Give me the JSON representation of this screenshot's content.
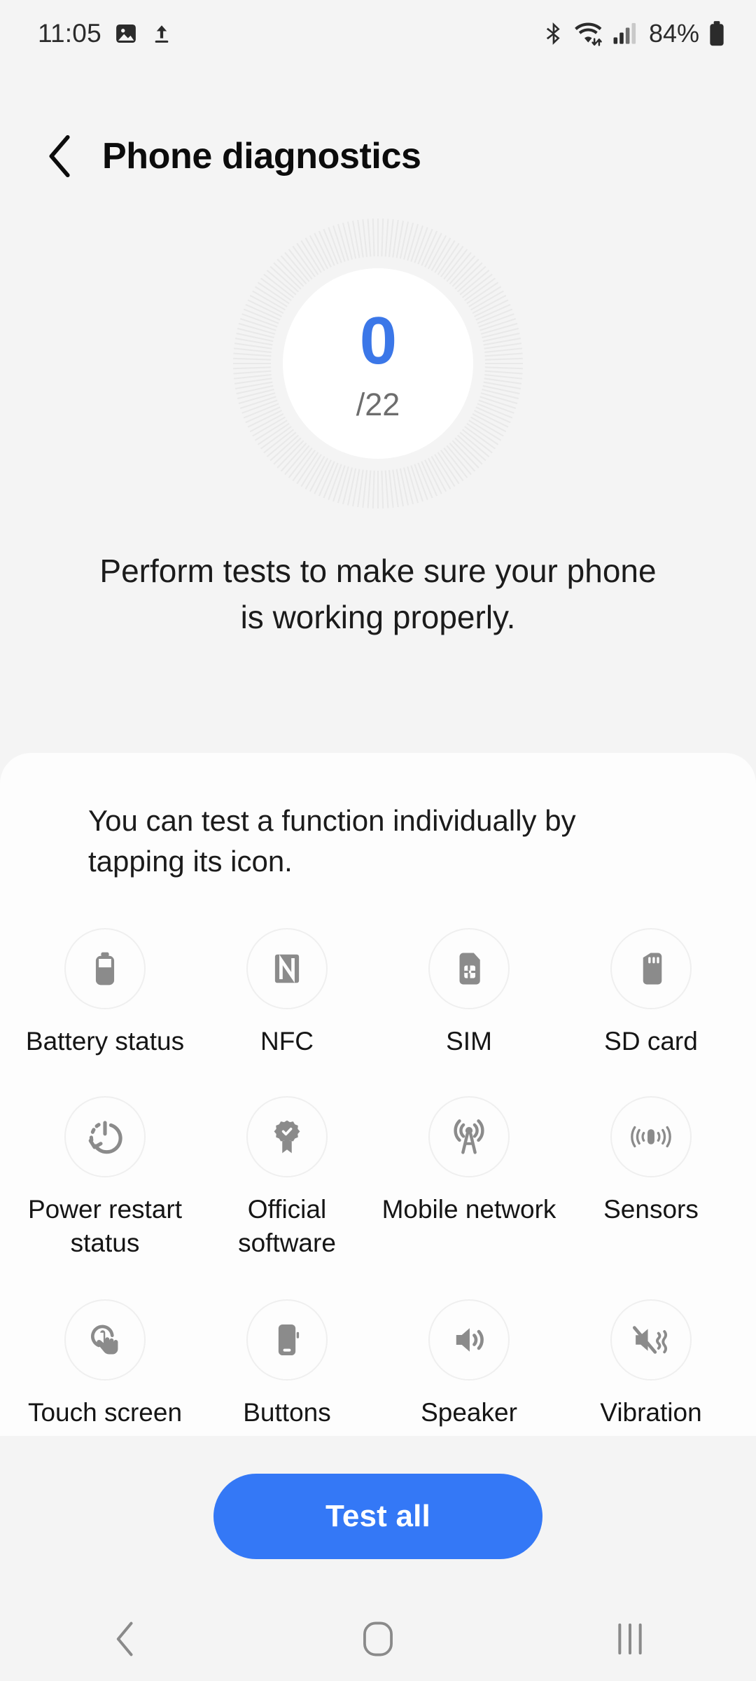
{
  "status_bar": {
    "clock": "11:05",
    "battery_percent": "84%",
    "left_icons": [
      "image-icon",
      "upload-icon"
    ],
    "right_icons": [
      "bluetooth-icon",
      "wifi-icon",
      "signal-icon",
      "battery-icon"
    ]
  },
  "header": {
    "back_icon": "chevron-left-icon",
    "title": "Phone diagnostics"
  },
  "gauge": {
    "score": "0",
    "total": "/22",
    "score_color": "#3b77e8",
    "tick_color": "#e9e9e9",
    "tick_count": 180
  },
  "description": "Perform tests to make sure your phone is working properly.",
  "card": {
    "hint": "You can test a function individually by tapping its icon.",
    "items": [
      {
        "label": "Battery status",
        "icon": "battery-status-icon"
      },
      {
        "label": "NFC",
        "icon": "nfc-icon"
      },
      {
        "label": "SIM",
        "icon": "sim-card-icon"
      },
      {
        "label": "SD card",
        "icon": "sd-card-icon"
      },
      {
        "label": "Power restart status",
        "icon": "power-restart-icon"
      },
      {
        "label": "Official software",
        "icon": "certified-badge-icon"
      },
      {
        "label": "Mobile network",
        "icon": "antenna-tower-icon"
      },
      {
        "label": "Sensors",
        "icon": "sensors-icon"
      },
      {
        "label": "Touch screen",
        "icon": "touch-hand-icon"
      },
      {
        "label": "Buttons",
        "icon": "phone-button-icon"
      },
      {
        "label": "Speaker",
        "icon": "speaker-icon"
      },
      {
        "label": "Vibration",
        "icon": "vibration-mute-icon"
      }
    ]
  },
  "footer": {
    "test_all_label": "Test all",
    "accent_color": "#3478f6"
  },
  "navbar": {
    "back_icon": "nav-back-icon",
    "home_icon": "nav-home-icon",
    "recents_icon": "nav-recents-icon"
  }
}
